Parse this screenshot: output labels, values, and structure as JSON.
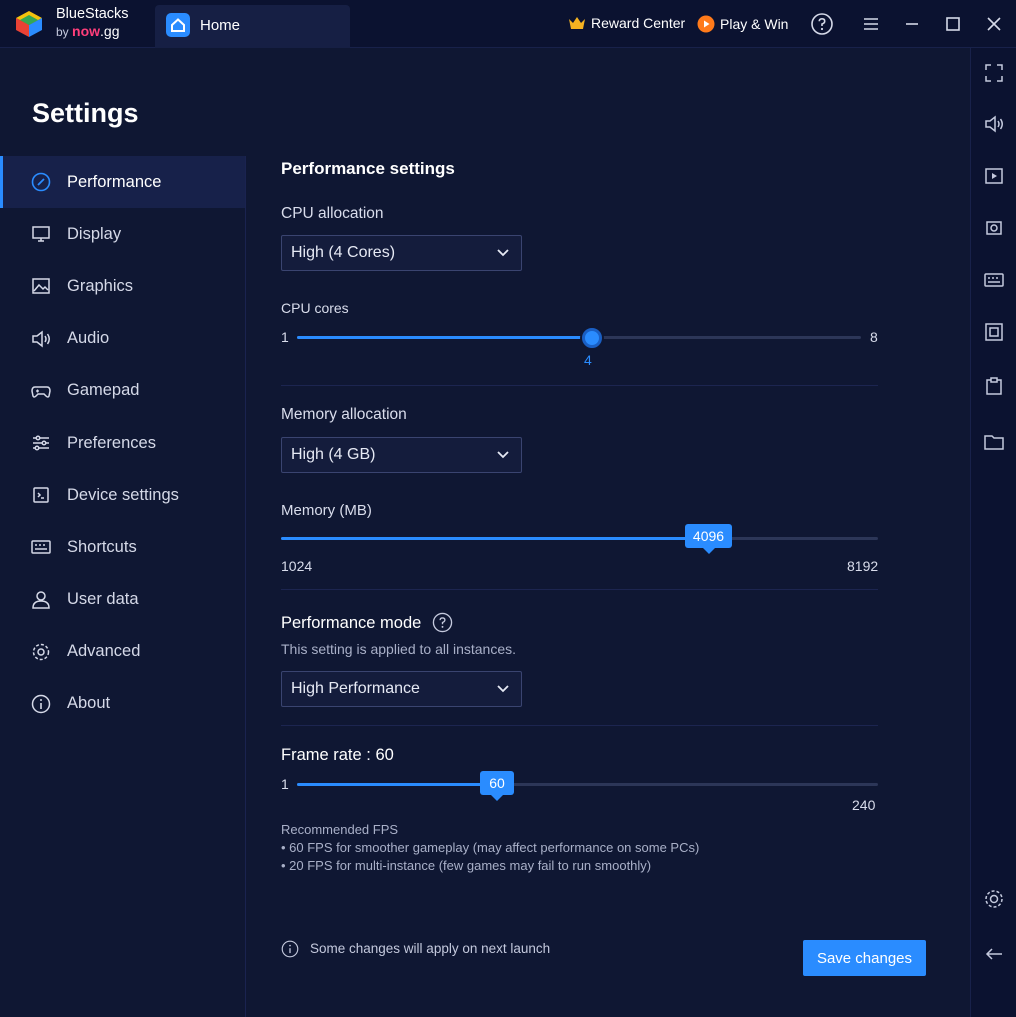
{
  "titlebar": {
    "brand_name": "BlueStacks",
    "brand_by": "by",
    "brand_now": "now",
    "brand_gg": ".gg",
    "home_tab": "Home",
    "reward_center": "Reward Center",
    "play_win": "Play & Win"
  },
  "settings": {
    "title": "Settings",
    "sidebar": [
      {
        "label": "Performance",
        "icon": "performance-icon",
        "active": true
      },
      {
        "label": "Display",
        "icon": "display-icon"
      },
      {
        "label": "Graphics",
        "icon": "graphics-icon"
      },
      {
        "label": "Audio",
        "icon": "audio-icon"
      },
      {
        "label": "Gamepad",
        "icon": "gamepad-icon"
      },
      {
        "label": "Preferences",
        "icon": "preferences-icon"
      },
      {
        "label": "Device settings",
        "icon": "device-settings-icon"
      },
      {
        "label": "Shortcuts",
        "icon": "keyboard-icon"
      },
      {
        "label": "User data",
        "icon": "user-icon"
      },
      {
        "label": "Advanced",
        "icon": "gear-icon"
      },
      {
        "label": "About",
        "icon": "info-icon"
      }
    ]
  },
  "performance": {
    "heading": "Performance settings",
    "cpu_allocation_label": "CPU allocation",
    "cpu_allocation_value": "High (4 Cores)",
    "cpu_cores_label": "CPU cores",
    "cpu_cores_min": "1",
    "cpu_cores_max": "8",
    "cpu_cores_value": "4",
    "memory_allocation_label": "Memory allocation",
    "memory_allocation_value": "High (4 GB)",
    "memory_label": "Memory (MB)",
    "memory_min": "1024",
    "memory_max": "8192",
    "memory_value": "4096",
    "mode_label": "Performance mode",
    "mode_note": "This setting is applied to all instances.",
    "mode_value": "High Performance",
    "frame_rate_label": "Frame rate : 60",
    "frame_rate_min": "1",
    "frame_rate_max": "240",
    "frame_rate_value": "60",
    "fps_recommended": "Recommended FPS",
    "fps_note_1": "• 60 FPS for smoother gameplay (may affect performance on some PCs)",
    "fps_note_2": "• 20 FPS for multi-instance (few games may fail to run smoothly)",
    "launch_note": "Some changes will apply on next launch",
    "save_label": "Save changes"
  },
  "colors": {
    "accent": "#2a8cff",
    "background": "#0f1733",
    "titlebar": "#0b1230"
  }
}
